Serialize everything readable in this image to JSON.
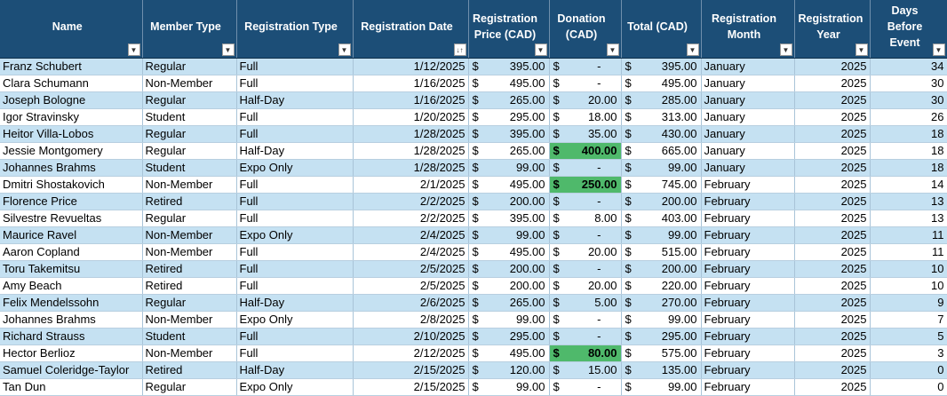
{
  "headers": [
    {
      "label": "Name",
      "filter_icon": "chevron-down-icon"
    },
    {
      "label": "Member Type",
      "filter_icon": "chevron-down-icon"
    },
    {
      "label": "Registration Type",
      "filter_icon": "chevron-down-icon"
    },
    {
      "label": "Registration Date",
      "filter_icon": "sort-ascending-icon"
    },
    {
      "label": "Registration Price (CAD)",
      "filter_icon": "chevron-down-icon"
    },
    {
      "label": "Donation (CAD)",
      "filter_icon": "chevron-down-icon"
    },
    {
      "label": "Total (CAD)",
      "filter_icon": "chevron-down-icon"
    },
    {
      "label": "Registration Month",
      "filter_icon": "chevron-down-icon"
    },
    {
      "label": "Registration Year",
      "filter_icon": "chevron-down-icon"
    },
    {
      "label": "Days Before Event",
      "filter_icon": "chevron-down-icon"
    }
  ],
  "currency_symbol": "$",
  "highlight_color": "#4fb96b",
  "rows": [
    {
      "name": "Franz Schubert",
      "member": "Regular",
      "reg_type": "Full",
      "date": "1/12/2025",
      "price": "395.00",
      "donation": "-",
      "total": "395.00",
      "month": "January",
      "year": "2025",
      "days": "34"
    },
    {
      "name": "Clara Schumann",
      "member": "Non-Member",
      "reg_type": "Full",
      "date": "1/16/2025",
      "price": "495.00",
      "donation": "-",
      "total": "495.00",
      "month": "January",
      "year": "2025",
      "days": "30"
    },
    {
      "name": "Joseph Bologne",
      "member": "Regular",
      "reg_type": "Half-Day",
      "date": "1/16/2025",
      "price": "265.00",
      "donation": "20.00",
      "total": "285.00",
      "month": "January",
      "year": "2025",
      "days": "30"
    },
    {
      "name": "Igor Stravinsky",
      "member": "Student",
      "reg_type": "Full",
      "date": "1/20/2025",
      "price": "295.00",
      "donation": "18.00",
      "total": "313.00",
      "month": "January",
      "year": "2025",
      "days": "26"
    },
    {
      "name": "Heitor Villa-Lobos",
      "member": "Regular",
      "reg_type": "Full",
      "date": "1/28/2025",
      "price": "395.00",
      "donation": "35.00",
      "total": "430.00",
      "month": "January",
      "year": "2025",
      "days": "18"
    },
    {
      "name": "Jessie Montgomery",
      "member": "Regular",
      "reg_type": "Half-Day",
      "date": "1/28/2025",
      "price": "265.00",
      "donation": "400.00",
      "total": "665.00",
      "month": "January",
      "year": "2025",
      "days": "18",
      "donation_highlight": true
    },
    {
      "name": "Johannes Brahms",
      "member": "Student",
      "reg_type": "Expo Only",
      "date": "1/28/2025",
      "price": "99.00",
      "donation": "-",
      "total": "99.00",
      "month": "January",
      "year": "2025",
      "days": "18"
    },
    {
      "name": "Dmitri Shostakovich",
      "member": "Non-Member",
      "reg_type": "Full",
      "date": "2/1/2025",
      "price": "495.00",
      "donation": "250.00",
      "total": "745.00",
      "month": "February",
      "year": "2025",
      "days": "14",
      "donation_highlight": true
    },
    {
      "name": "Florence Price",
      "member": "Retired",
      "reg_type": "Full",
      "date": "2/2/2025",
      "price": "200.00",
      "donation": "-",
      "total": "200.00",
      "month": "February",
      "year": "2025",
      "days": "13"
    },
    {
      "name": "Silvestre Revueltas",
      "member": "Regular",
      "reg_type": "Full",
      "date": "2/2/2025",
      "price": "395.00",
      "donation": "8.00",
      "total": "403.00",
      "month": "February",
      "year": "2025",
      "days": "13"
    },
    {
      "name": "Maurice Ravel",
      "member": "Non-Member",
      "reg_type": "Expo Only",
      "date": "2/4/2025",
      "price": "99.00",
      "donation": "-",
      "total": "99.00",
      "month": "February",
      "year": "2025",
      "days": "11"
    },
    {
      "name": "Aaron Copland",
      "member": "Non-Member",
      "reg_type": "Full",
      "date": "2/4/2025",
      "price": "495.00",
      "donation": "20.00",
      "total": "515.00",
      "month": "February",
      "year": "2025",
      "days": "11"
    },
    {
      "name": "Toru Takemitsu",
      "member": "Retired",
      "reg_type": "Full",
      "date": "2/5/2025",
      "price": "200.00",
      "donation": "-",
      "total": "200.00",
      "month": "February",
      "year": "2025",
      "days": "10"
    },
    {
      "name": "Amy Beach",
      "member": "Retired",
      "reg_type": "Full",
      "date": "2/5/2025",
      "price": "200.00",
      "donation": "20.00",
      "total": "220.00",
      "month": "February",
      "year": "2025",
      "days": "10"
    },
    {
      "name": "Felix Mendelssohn",
      "member": "Regular",
      "reg_type": "Half-Day",
      "date": "2/6/2025",
      "price": "265.00",
      "donation": "5.00",
      "total": "270.00",
      "month": "February",
      "year": "2025",
      "days": "9"
    },
    {
      "name": "Johannes Brahms",
      "member": "Non-Member",
      "reg_type": "Expo Only",
      "date": "2/8/2025",
      "price": "99.00",
      "donation": "-",
      "total": "99.00",
      "month": "February",
      "year": "2025",
      "days": "7"
    },
    {
      "name": "Richard Strauss",
      "member": "Student",
      "reg_type": "Full",
      "date": "2/10/2025",
      "price": "295.00",
      "donation": "-",
      "total": "295.00",
      "month": "February",
      "year": "2025",
      "days": "5"
    },
    {
      "name": "Hector Berlioz",
      "member": "Non-Member",
      "reg_type": "Full",
      "date": "2/12/2025",
      "price": "495.00",
      "donation": "80.00",
      "total": "575.00",
      "month": "February",
      "year": "2025",
      "days": "3",
      "donation_highlight": true
    },
    {
      "name": "Samuel Coleridge-Taylor",
      "member": "Retired",
      "reg_type": "Half-Day",
      "date": "2/15/2025",
      "price": "120.00",
      "donation": "15.00",
      "total": "135.00",
      "month": "February",
      "year": "2025",
      "days": "0"
    },
    {
      "name": "Tan Dun",
      "member": "Regular",
      "reg_type": "Expo Only",
      "date": "2/15/2025",
      "price": "99.00",
      "donation": "-",
      "total": "99.00",
      "month": "February",
      "year": "2025",
      "days": "0"
    }
  ]
}
